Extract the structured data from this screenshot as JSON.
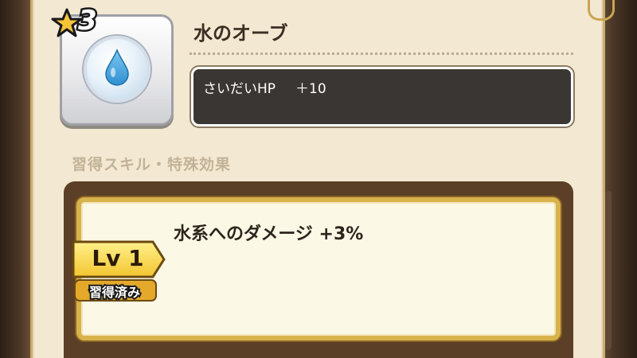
{
  "item": {
    "rarity": "3",
    "name": "水のオーブ",
    "icon": "water-drop-orb-icon"
  },
  "stats": {
    "label": "さいだいHP",
    "value": "＋10"
  },
  "section": {
    "title": "習得スキル・特殊効果"
  },
  "skill": {
    "level": "Lv 1",
    "status": "習得済み",
    "effect": "水系へのダメージ +3%"
  },
  "colors": {
    "panel": "#f3e8d2",
    "stat_bg": "#3a3633",
    "gold": "#d8b24b",
    "water": "#3a9bd9"
  }
}
